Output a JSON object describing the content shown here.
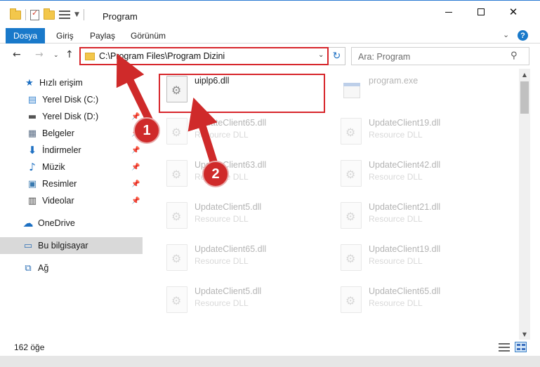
{
  "window": {
    "title": "Program",
    "minimize": "—",
    "close": "✕"
  },
  "ribbon": {
    "tabs": [
      "Dosya",
      "Giriş",
      "Paylaş",
      "Görünüm"
    ],
    "help": "?"
  },
  "address": {
    "path": "C:\\Program Files\\Program Dizini",
    "search_placeholder": "Ara: Program"
  },
  "sidebar": {
    "items": [
      {
        "label": "Hızlı erişim",
        "icon": "star-icon",
        "pinned": false
      },
      {
        "label": "Yerel Disk (C:)",
        "icon": "drive-icon",
        "pinned": true
      },
      {
        "label": "Yerel Disk (D:)",
        "icon": "drive-icon",
        "pinned": true
      },
      {
        "label": "Belgeler",
        "icon": "documents-icon",
        "pinned": true
      },
      {
        "label": "İndirmeler",
        "icon": "download-icon",
        "pinned": true
      },
      {
        "label": "Müzik",
        "icon": "music-icon",
        "pinned": true
      },
      {
        "label": "Resimler",
        "icon": "pictures-icon",
        "pinned": true
      },
      {
        "label": "Videolar",
        "icon": "video-icon",
        "pinned": true
      },
      {
        "label": "OneDrive",
        "icon": "cloud-icon",
        "pinned": false
      },
      {
        "label": "Bu bilgisayar",
        "icon": "computer-icon",
        "pinned": false,
        "selected": true
      },
      {
        "label": "Ağ",
        "icon": "network-icon",
        "pinned": false
      }
    ]
  },
  "files": {
    "highlighted": {
      "name": "uiplp6.dll"
    },
    "exe": {
      "name": "program.exe"
    },
    "rows": [
      [
        {
          "name": "UpdateClient65.dll",
          "type": "Resource DLL"
        },
        {
          "name": "UpdateClient19.dll",
          "type": "Resource DLL"
        }
      ],
      [
        {
          "name": "UpdateClient63.dll",
          "type": "Resource DLL"
        },
        {
          "name": "UpdateClient42.dll",
          "type": "Resource DLL"
        }
      ],
      [
        {
          "name": "UpdateClient5.dll",
          "type": "Resource DLL"
        },
        {
          "name": "UpdateClient21.dll",
          "type": "Resource DLL"
        }
      ],
      [
        {
          "name": "UpdateClient65.dll",
          "type": "Resource DLL"
        },
        {
          "name": "UpdateClient19.dll",
          "type": "Resource DLL"
        }
      ],
      [
        {
          "name": "UpdateClient5.dll",
          "type": "Resource DLL"
        },
        {
          "name": "UpdateClient65.dll",
          "type": "Resource DLL"
        }
      ]
    ]
  },
  "status": {
    "count": "162 öğe"
  },
  "annotations": {
    "step1": "1",
    "step2": "2",
    "color": "#cf2a2a"
  }
}
